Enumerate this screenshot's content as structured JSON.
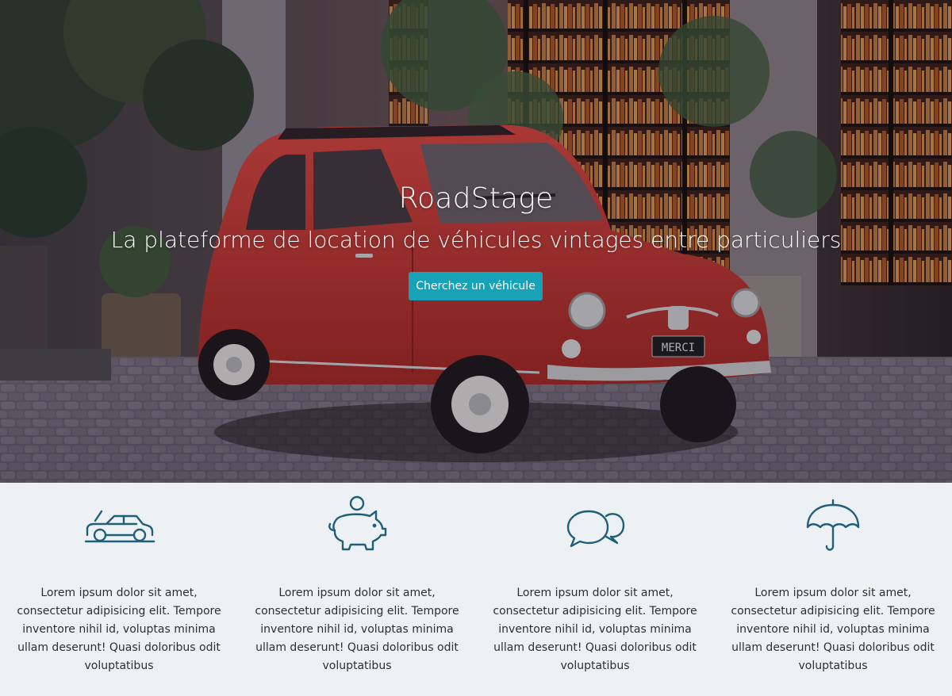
{
  "hero": {
    "title": "RoadStage",
    "subtitle": "La plateforme de location de véhicules vintages entre particuliers",
    "cta_label": "Cherchez un véhicule",
    "plate_text": "MERCI"
  },
  "features": [
    {
      "icon": "car-icon",
      "text": "Lorem ipsum dolor sit amet, consectetur adipisicing elit. Tempore inventore nihil id, voluptas minima ullam deserunt! Quasi doloribus odit voluptatibus"
    },
    {
      "icon": "piggy-bank-icon",
      "text": "Lorem ipsum dolor sit amet, consectetur adipisicing elit. Tempore inventore nihil id, voluptas minima ullam deserunt! Quasi doloribus odit voluptatibus"
    },
    {
      "icon": "chat-bubbles-icon",
      "text": "Lorem ipsum dolor sit amet, consectetur adipisicing elit. Tempore inventore nihil id, voluptas minima ullam deserunt! Quasi doloribus odit voluptatibus"
    },
    {
      "icon": "umbrella-icon",
      "text": "Lorem ipsum dolor sit amet, consectetur adipisicing elit. Tempore inventore nihil id, voluptas minima ullam deserunt! Quasi doloribus odit voluptatibus"
    }
  ],
  "colors": {
    "accent": "#17a2b8",
    "icon_stroke": "#1f5f7a",
    "features_bg": "#eef1f3",
    "text": "#28303a",
    "car_red": "#d63c35"
  }
}
